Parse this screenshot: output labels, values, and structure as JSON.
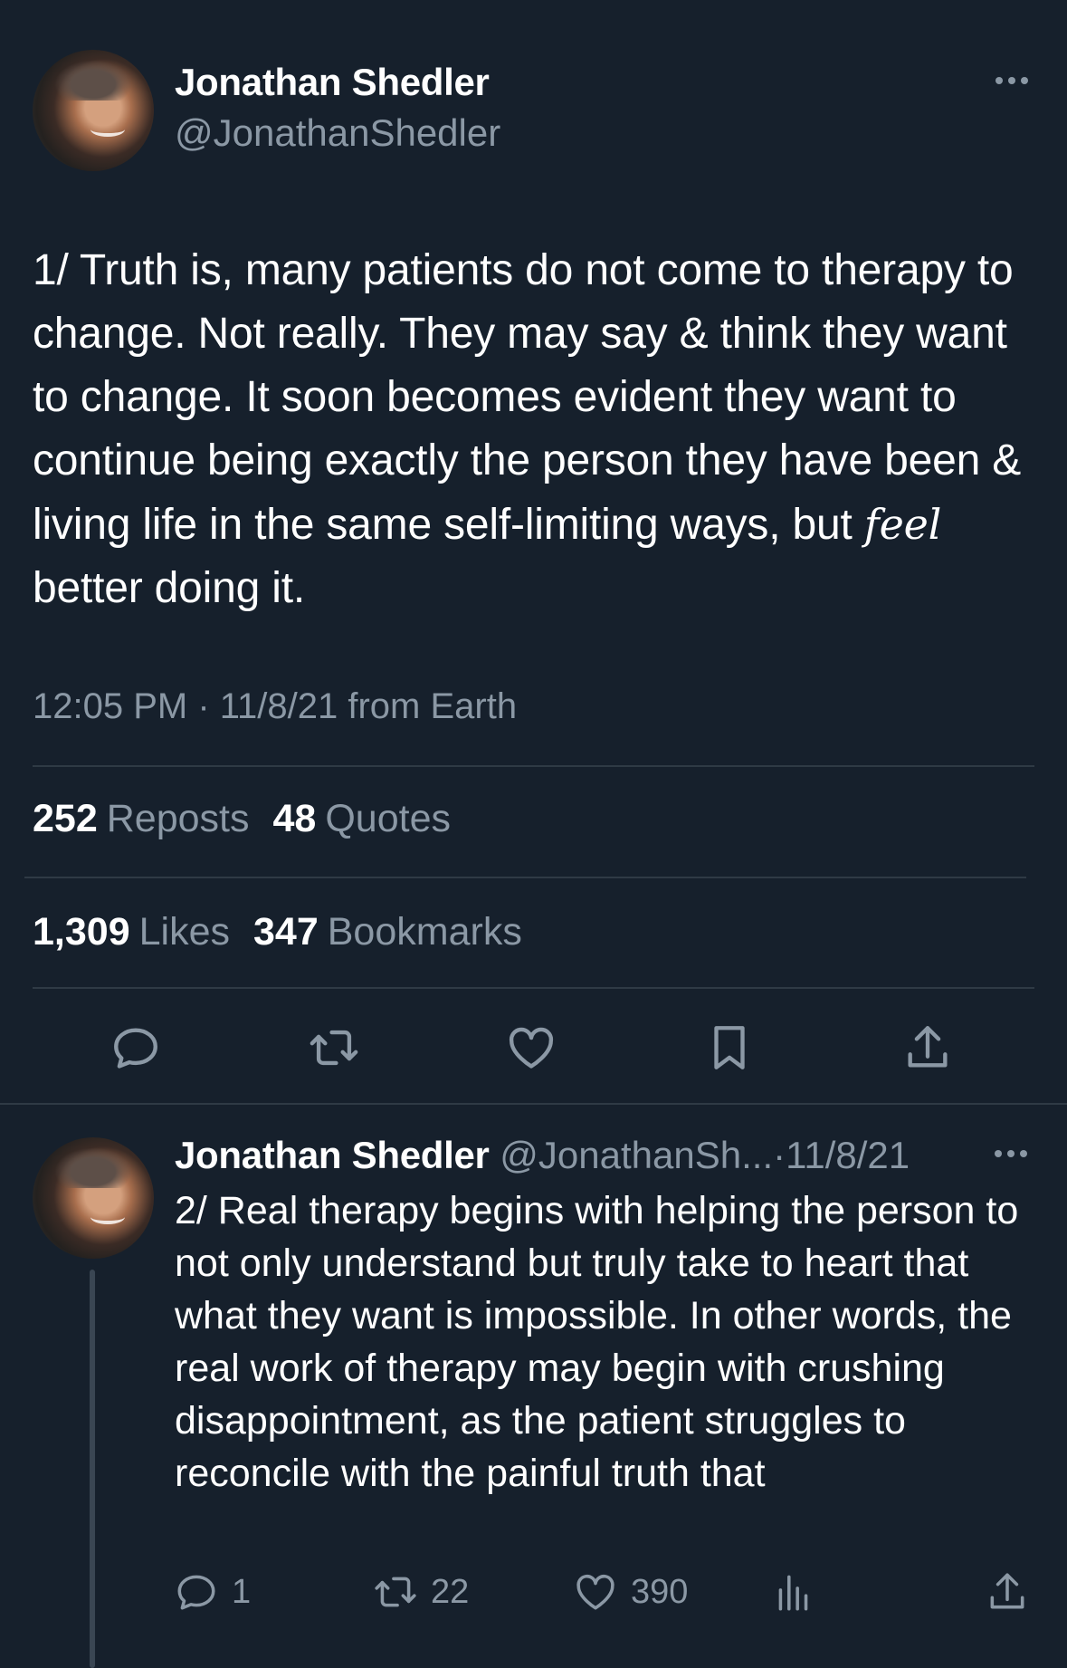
{
  "main_tweet": {
    "author_name": "Jonathan Shedler",
    "author_handle": "@JonathanShedler",
    "text_before_em": "1/ Truth is, many patients do not come to therapy to change. Not really. They may say & think they want to change. It soon becomes evident they want to continue being exactly the person they have been & living life in the same self-limiting ways, but ",
    "text_em": "feel",
    "text_after_em": " better doing it.",
    "meta": "12:05 PM · 11/8/21 from Earth",
    "stats": {
      "reposts_count": "252",
      "reposts_label": "Reposts",
      "quotes_count": "48",
      "quotes_label": "Quotes",
      "likes_count": "1,309",
      "likes_label": "Likes",
      "bookmarks_count": "347",
      "bookmarks_label": "Bookmarks"
    },
    "actions": [
      "reply-icon",
      "repost-icon",
      "like-icon",
      "bookmark-icon",
      "share-icon"
    ]
  },
  "reply_tweet": {
    "author_name": "Jonathan Shedler",
    "author_handle": "@JonathanSh...",
    "separator": "·",
    "date": "11/8/21",
    "text": "2/ Real therapy begins with helping the person to not only understand but truly take to heart that what they want is impossible. In other words, the real work of therapy may begin with crushing disappointment, as the patient struggles to reconcile with the painful truth that",
    "replies": "1",
    "reposts": "22",
    "likes": "390",
    "actions": [
      "reply-icon",
      "repost-icon",
      "like-icon",
      "views-icon",
      "share-icon"
    ]
  },
  "colors": {
    "background": "#16202c",
    "text_primary": "#ffffff",
    "text_secondary": "#8b98a5",
    "divider": "#2f3a45"
  }
}
